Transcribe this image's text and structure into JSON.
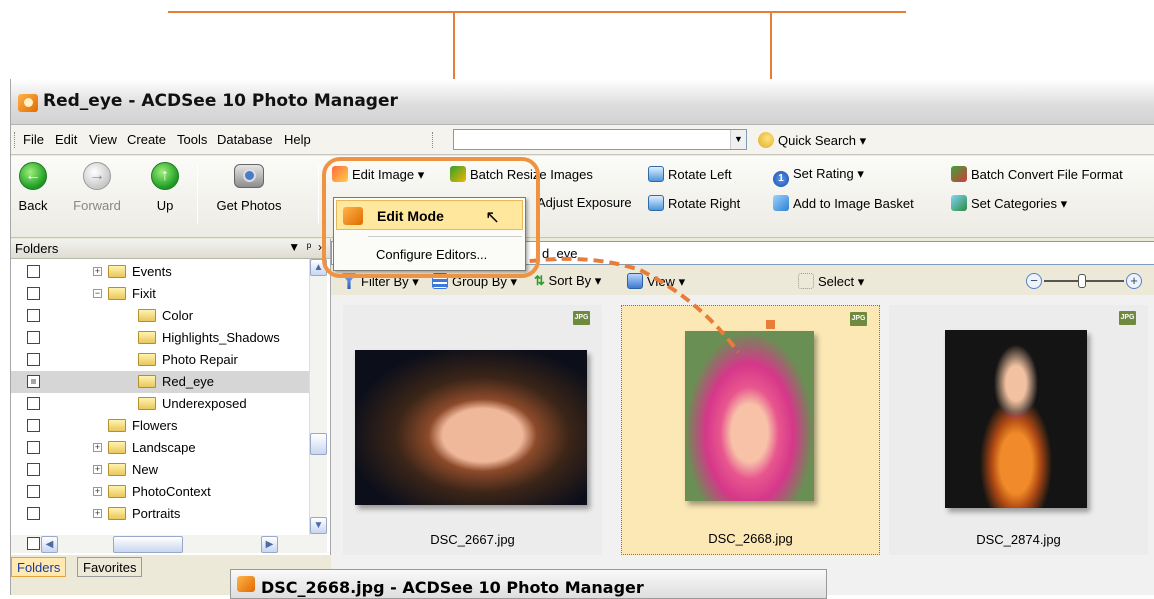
{
  "window": {
    "title": "Red_eye - ACDSee 10 Photo Manager"
  },
  "menu": [
    "File",
    "Edit",
    "View",
    "Create",
    "Tools",
    "Database",
    "Help"
  ],
  "search": {
    "placeholder": "",
    "quick_search_label": "Quick Search"
  },
  "nav": {
    "back": "Back",
    "forward": "Forward",
    "up": "Up",
    "get_photos": "Get Photos"
  },
  "toolbar": {
    "edit_image": "Edit Image",
    "batch_resize": "Batch Resize Images",
    "adjust_exposure": "Adjust Exposure",
    "rotate_left": "Rotate Left",
    "rotate_right": "Rotate Right",
    "set_rating": "Set Rating",
    "add_basket": "Add to Image Basket",
    "batch_convert": "Batch Convert File Format",
    "set_categories": "Set Categories"
  },
  "edit_menu": {
    "edit_mode": "Edit Mode",
    "configure": "Configure Editors..."
  },
  "folders_panel": {
    "title": "Folders",
    "items": [
      {
        "label": "Events"
      },
      {
        "label": "Fixit"
      },
      {
        "label": "Color"
      },
      {
        "label": "Highlights_Shadows"
      },
      {
        "label": "Photo Repair"
      },
      {
        "label": "Red_eye"
      },
      {
        "label": "Underexposed"
      },
      {
        "label": "Flowers"
      },
      {
        "label": "Landscape"
      },
      {
        "label": "New"
      },
      {
        "label": "PhotoContext"
      },
      {
        "label": "Portraits"
      }
    ],
    "tabs": [
      "Folders",
      "Favorites"
    ]
  },
  "path": {
    "value": "d_eye"
  },
  "filterbar": {
    "filter": "Filter By",
    "group": "Group By",
    "sort": "Sort By",
    "view": "View",
    "select": "Select"
  },
  "thumbnails": [
    {
      "name": "DSC_2667.jpg",
      "badge": "JPG"
    },
    {
      "name": "DSC_2668.jpg",
      "badge": "JPG"
    },
    {
      "name": "DSC_2874.jpg",
      "badge": "JPG"
    }
  ],
  "second_window": {
    "title": "DSC_2668.jpg - ACDSee 10 Photo Manager"
  },
  "colors": {
    "annotation": "#e87d3a",
    "selection": "#fbe8b4"
  }
}
